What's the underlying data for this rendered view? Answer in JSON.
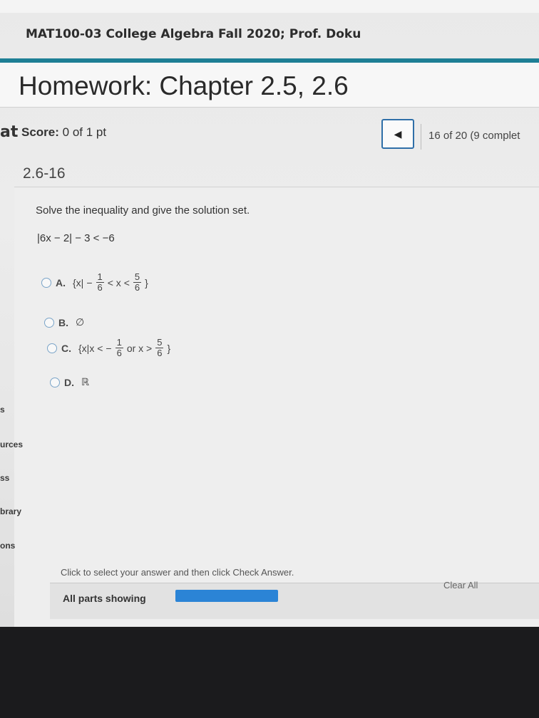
{
  "header": {
    "course_title": "MAT100-03 College Algebra Fall 2020; Prof. Doku",
    "homework_title": "Homework: Chapter 2.5, 2.6"
  },
  "score": {
    "label": "Score:",
    "value": "0 of 1 pt",
    "left_edge_fragment": "at"
  },
  "navigation": {
    "prev_icon": "triangle-left",
    "progress": "16 of 20 (9 complet"
  },
  "question": {
    "id": "2.6-16",
    "instruction": "Solve the inequality and give the solution set.",
    "problem": "|6x − 2| − 3 < −6",
    "options": [
      {
        "letter": "A.",
        "prefix": "{x|",
        "neg_sign": "−",
        "f1_num": "1",
        "f1_den": "6",
        "middle": "< x <",
        "f2_num": "5",
        "f2_den": "6",
        "suffix": "}"
      },
      {
        "letter": "B.",
        "text": "∅"
      },
      {
        "letter": "C.",
        "prefix": "{x|x <",
        "neg_sign": "−",
        "f1_num": "1",
        "f1_den": "6",
        "middle": "or x >",
        "f2_num": "5",
        "f2_den": "6",
        "suffix": "}"
      },
      {
        "letter": "D.",
        "text": "ℝ"
      }
    ]
  },
  "left_nav": {
    "items": [
      "s",
      "urces",
      "ss",
      "brary",
      "ons"
    ]
  },
  "footer": {
    "hint": "Click to select your answer and then click Check Answer.",
    "all_parts": "All parts showing",
    "clear_all": "Clear All"
  },
  "colors": {
    "accent_teal": "#1e7f95",
    "nav_border": "#2f6fa8",
    "parts_bar": "#2b84d6"
  }
}
